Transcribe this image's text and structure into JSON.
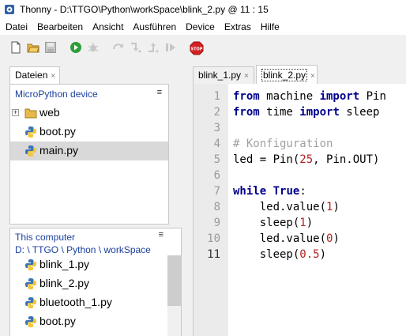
{
  "window": {
    "title": "Thonny  -  D:\\TTGO\\Python\\workSpace\\blink_2.py  @  11 : 15"
  },
  "menu": {
    "items": [
      "Datei",
      "Bearbeiten",
      "Ansicht",
      "Ausführen",
      "Device",
      "Extras",
      "Hilfe"
    ]
  },
  "toolbar": {
    "buttons": [
      "new-file-icon",
      "open-folder-icon",
      "save-icon",
      "run-icon",
      "debug-icon",
      "step-over-icon",
      "step-into-icon",
      "step-out-icon",
      "resume-icon",
      "stop-icon"
    ],
    "stop_label": "STOP"
  },
  "files_tab": {
    "label": "Dateien",
    "close": "×"
  },
  "device_panel": {
    "title": "MicroPython device",
    "menu": "≡",
    "items": [
      {
        "label": "web",
        "icon": "folder-icon",
        "expander": "+"
      },
      {
        "label": "boot.py",
        "icon": "python-file-icon"
      },
      {
        "label": "main.py",
        "icon": "python-file-icon",
        "selected": true
      }
    ]
  },
  "computer_panel": {
    "title": "This computer",
    "menu": "≡",
    "path": "D: \\ TTGO \\ Python \\ workSpace",
    "items": [
      {
        "label": "blink_1.py",
        "icon": "python-file-icon"
      },
      {
        "label": "blink_2.py",
        "icon": "python-file-icon"
      },
      {
        "label": "bluetooth_1.py",
        "icon": "python-file-icon"
      },
      {
        "label": "boot.py",
        "icon": "python-file-icon"
      }
    ]
  },
  "editor_tabs": [
    {
      "label": "blink_1.py",
      "close": "×",
      "active": false
    },
    {
      "label": "blink_2.py",
      "close": "×",
      "active": true
    }
  ],
  "editor": {
    "line_numbers": [
      "1",
      "2",
      "3",
      "4",
      "5",
      "6",
      "7",
      "8",
      "9",
      "10",
      "11"
    ],
    "current_line": 11,
    "lines": [
      [
        [
          "kw",
          "from"
        ],
        [
          "t",
          " machine "
        ],
        [
          "kw",
          "import"
        ],
        [
          "t",
          " Pin"
        ]
      ],
      [
        [
          "kw",
          "from"
        ],
        [
          "t",
          " time "
        ],
        [
          "kw",
          "import"
        ],
        [
          "t",
          " sleep"
        ]
      ],
      [],
      [
        [
          "cmt",
          "# Konfiguration"
        ]
      ],
      [
        [
          "t",
          "led = Pin("
        ],
        [
          "num",
          "25"
        ],
        [
          "t",
          ", Pin.OUT)"
        ]
      ],
      [],
      [
        [
          "kw",
          "while"
        ],
        [
          "t",
          " "
        ],
        [
          "kw",
          "True"
        ],
        [
          "t",
          ":"
        ]
      ],
      [
        [
          "t",
          "    led.value("
        ],
        [
          "num",
          "1"
        ],
        [
          "t",
          ")"
        ]
      ],
      [
        [
          "t",
          "    sleep("
        ],
        [
          "num",
          "1"
        ],
        [
          "t",
          ")"
        ]
      ],
      [
        [
          "t",
          "    led.value("
        ],
        [
          "num",
          "0"
        ],
        [
          "t",
          ")"
        ]
      ],
      [
        [
          "t",
          "    sleep("
        ],
        [
          "num",
          "0.5"
        ],
        [
          "t",
          ")"
        ]
      ]
    ]
  },
  "colors": {
    "keyword": "#00008b",
    "comment": "#a0a0a0",
    "number": "#b22222",
    "panel_title": "#1a3f9e",
    "selection": "#d9d9d9"
  }
}
